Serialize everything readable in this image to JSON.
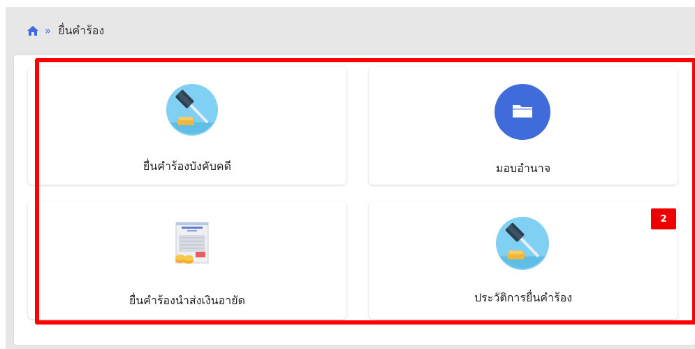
{
  "breadcrumb": {
    "home_icon": "home-icon",
    "separator": "»",
    "current": "ยื่นคำร้อง"
  },
  "cards": [
    {
      "label": "ยื่นคำร้องบังคับคดี",
      "icon": "gavel-icon"
    },
    {
      "label": "มอบอำนาจ",
      "icon": "folder-icon"
    },
    {
      "label": "ยื่นคำร้องนำส่งเงินอายัด",
      "icon": "document-coins-icon"
    },
    {
      "label": "ประวัติการยื่นคำร้อง",
      "icon": "gavel-icon",
      "badge": "2"
    }
  ],
  "colors": {
    "accent_blue": "#3f6bdb",
    "highlight_red": "#ff0000",
    "badge_red": "#ee0000",
    "gavel_bg": "#7fd0f2"
  }
}
